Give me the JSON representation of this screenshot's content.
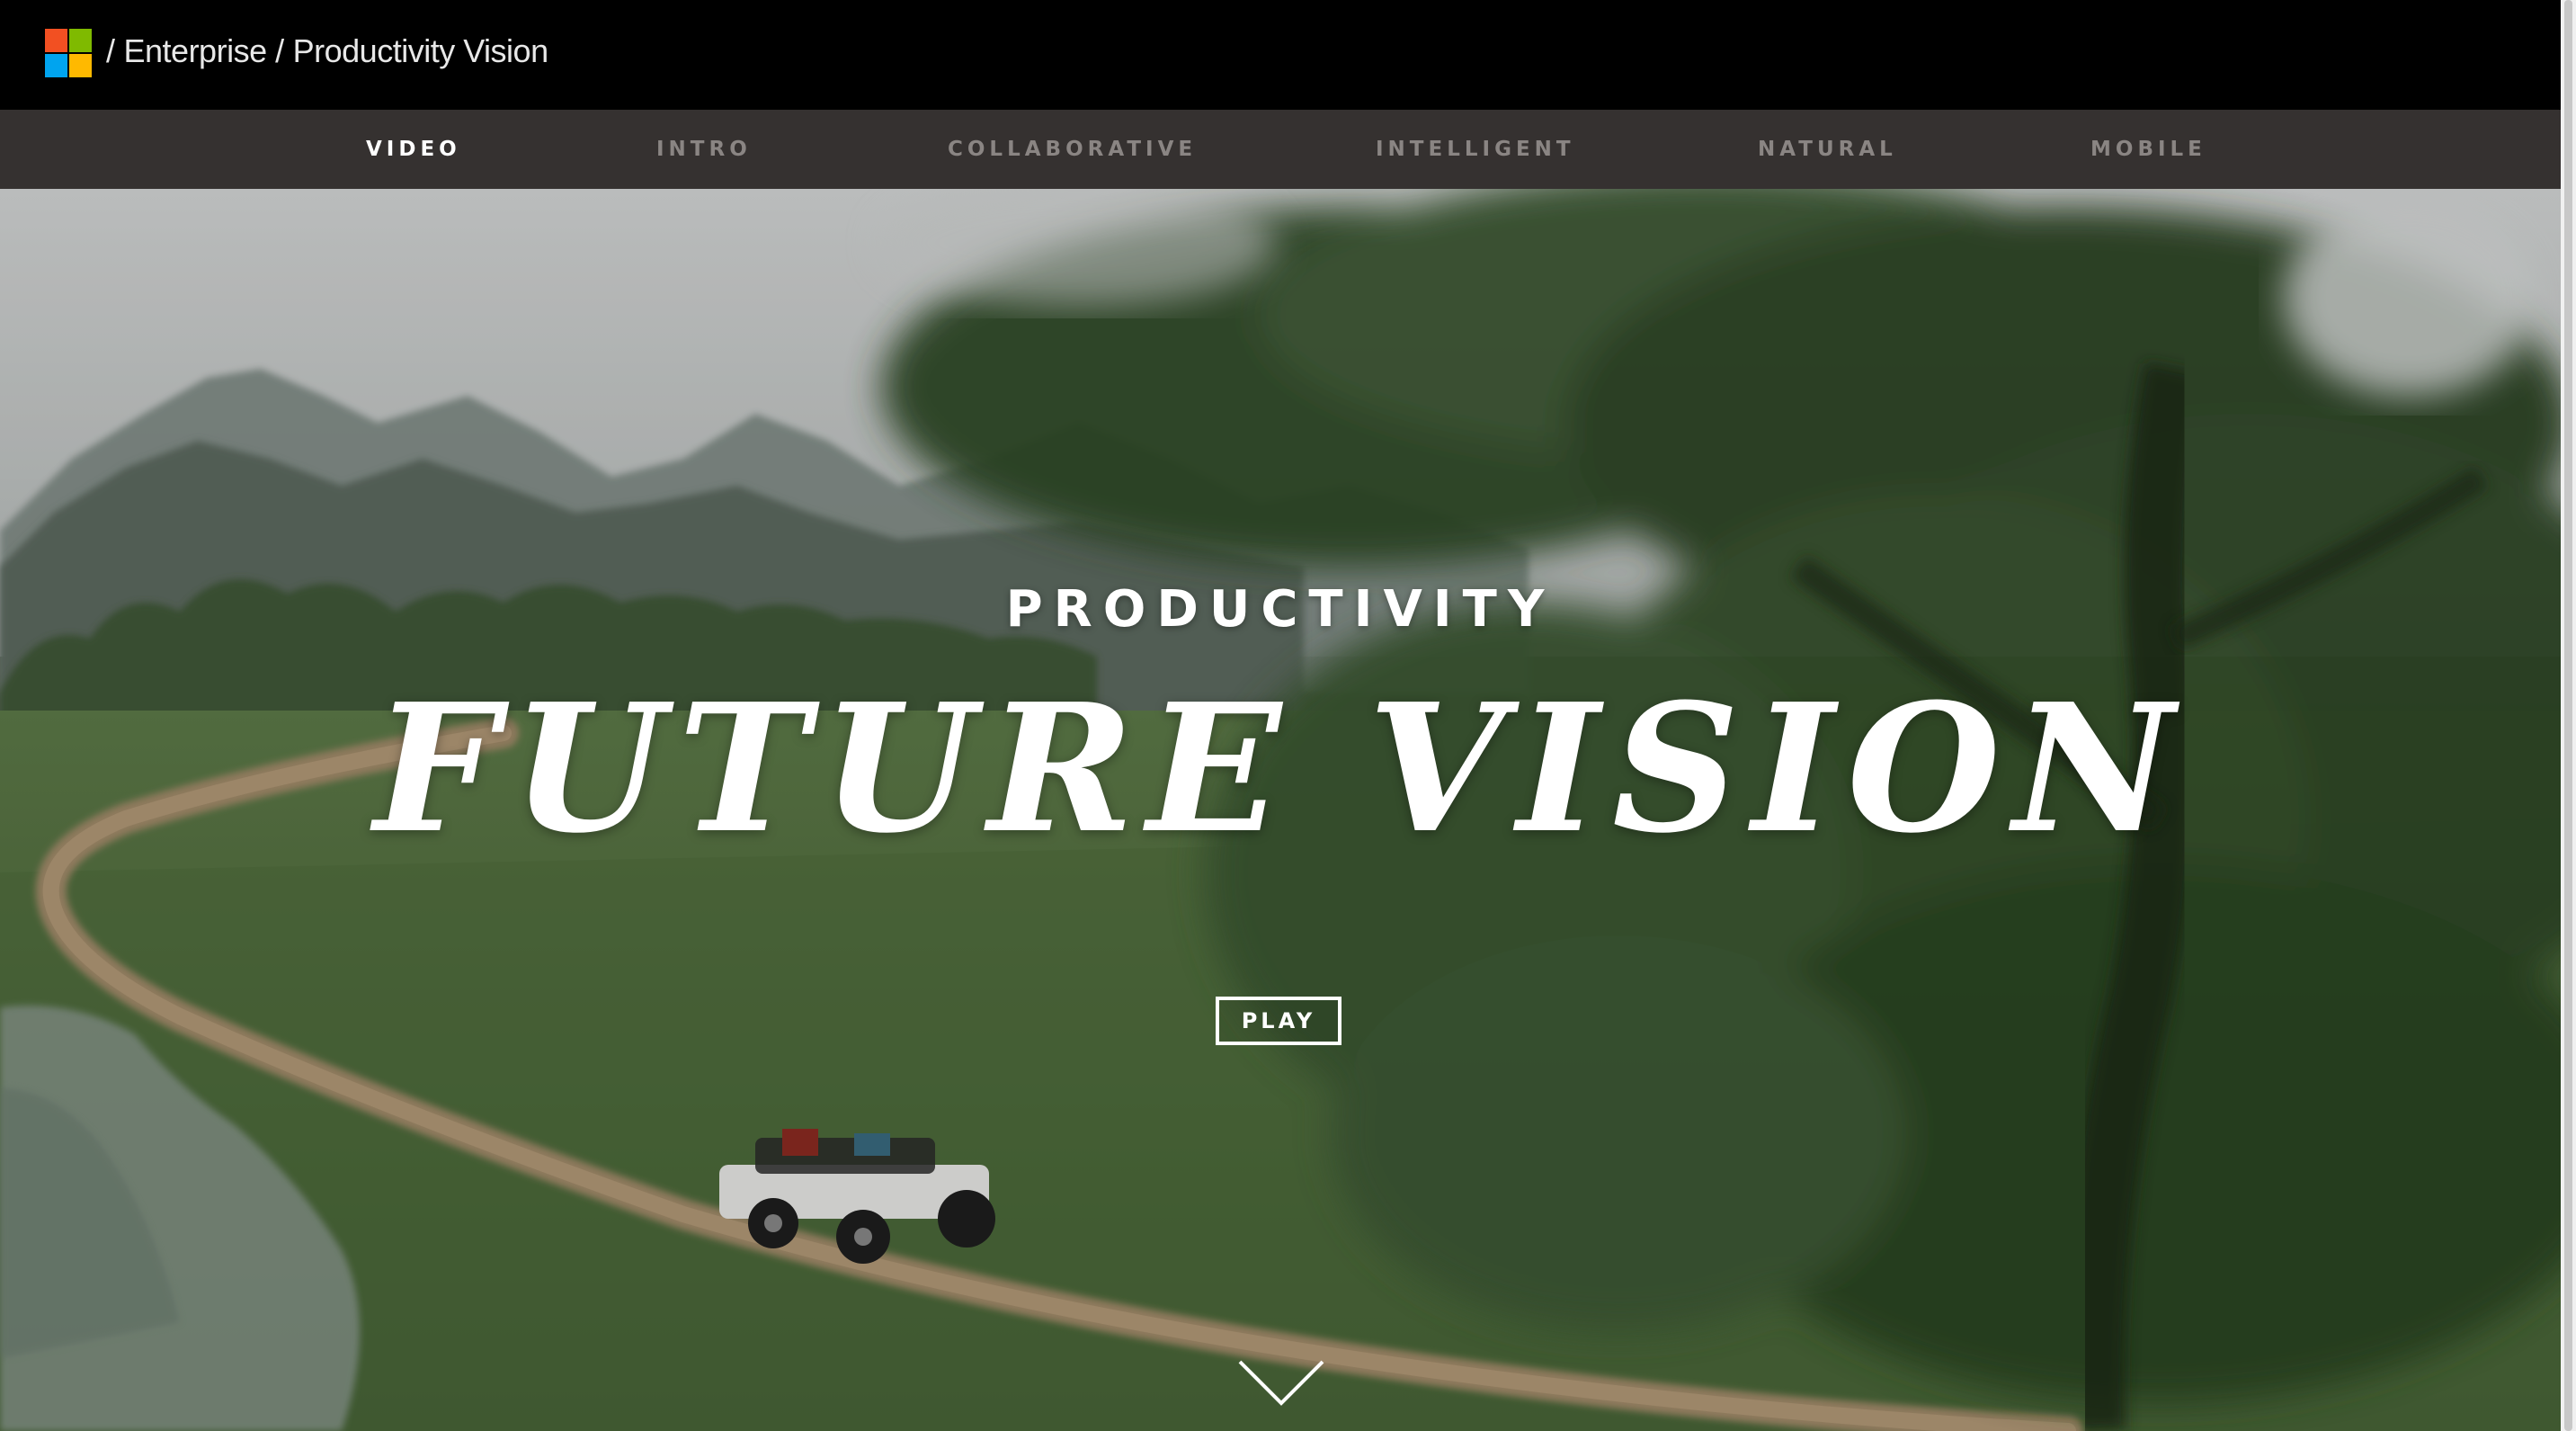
{
  "colors": {
    "logo_red": "#F25022",
    "logo_green": "#7FBA00",
    "logo_blue": "#00A4EF",
    "logo_yellow": "#FFB900",
    "top_bar": "#000000",
    "nav_bar": "#353130",
    "nav_inactive": "#8A8583",
    "nav_active": "#FFFFFF"
  },
  "header": {
    "logo_icon": "microsoft-logo-icon",
    "breadcrumb": {
      "separator": "/",
      "enterprise": "Enterprise",
      "current": "Productivity Vision"
    }
  },
  "nav": {
    "items": [
      {
        "label": "VIDEO",
        "active": true
      },
      {
        "label": "INTRO",
        "active": false
      },
      {
        "label": "COLLABORATIVE",
        "active": false
      },
      {
        "label": "INTELLIGENT",
        "active": false
      },
      {
        "label": "NATURAL",
        "active": false
      },
      {
        "label": "MOBILE",
        "active": false
      }
    ]
  },
  "hero": {
    "eyebrow": "PRODUCTIVITY",
    "title": "FUTURE VISION",
    "play_label": "PLAY",
    "scroll_icon": "chevron-down-icon",
    "background_description_icon": "video-still-image"
  }
}
